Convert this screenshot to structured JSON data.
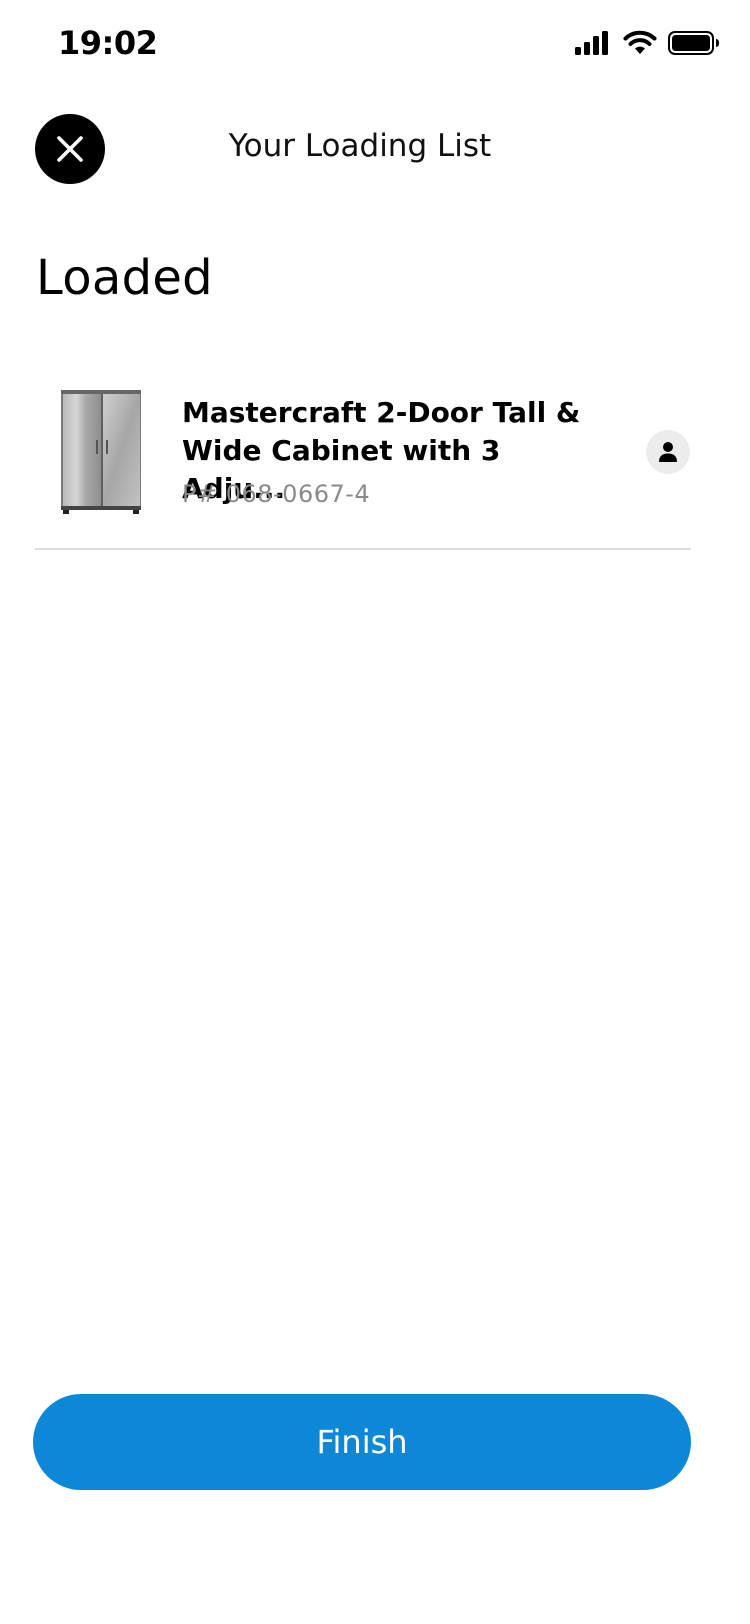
{
  "status_bar": {
    "time": "19:02",
    "icons": [
      "signal-icon",
      "wifi-icon",
      "battery-icon"
    ]
  },
  "header": {
    "close_icon": "close-icon",
    "title": "Your Loading List"
  },
  "section": {
    "heading": "Loaded"
  },
  "items": [
    {
      "title": "Mastercraft 2-Door Tall & Wide Cabinet with 3 Adju...",
      "part_number": "P# 068-0667-4",
      "image": "cabinet-image",
      "loader_icon": "person-icon"
    }
  ],
  "footer": {
    "finish_label": "Finish"
  },
  "colors": {
    "primary": "#0d88d6",
    "text": "#111111",
    "muted": "#8a8a8a",
    "divider": "#dcdcdc"
  }
}
